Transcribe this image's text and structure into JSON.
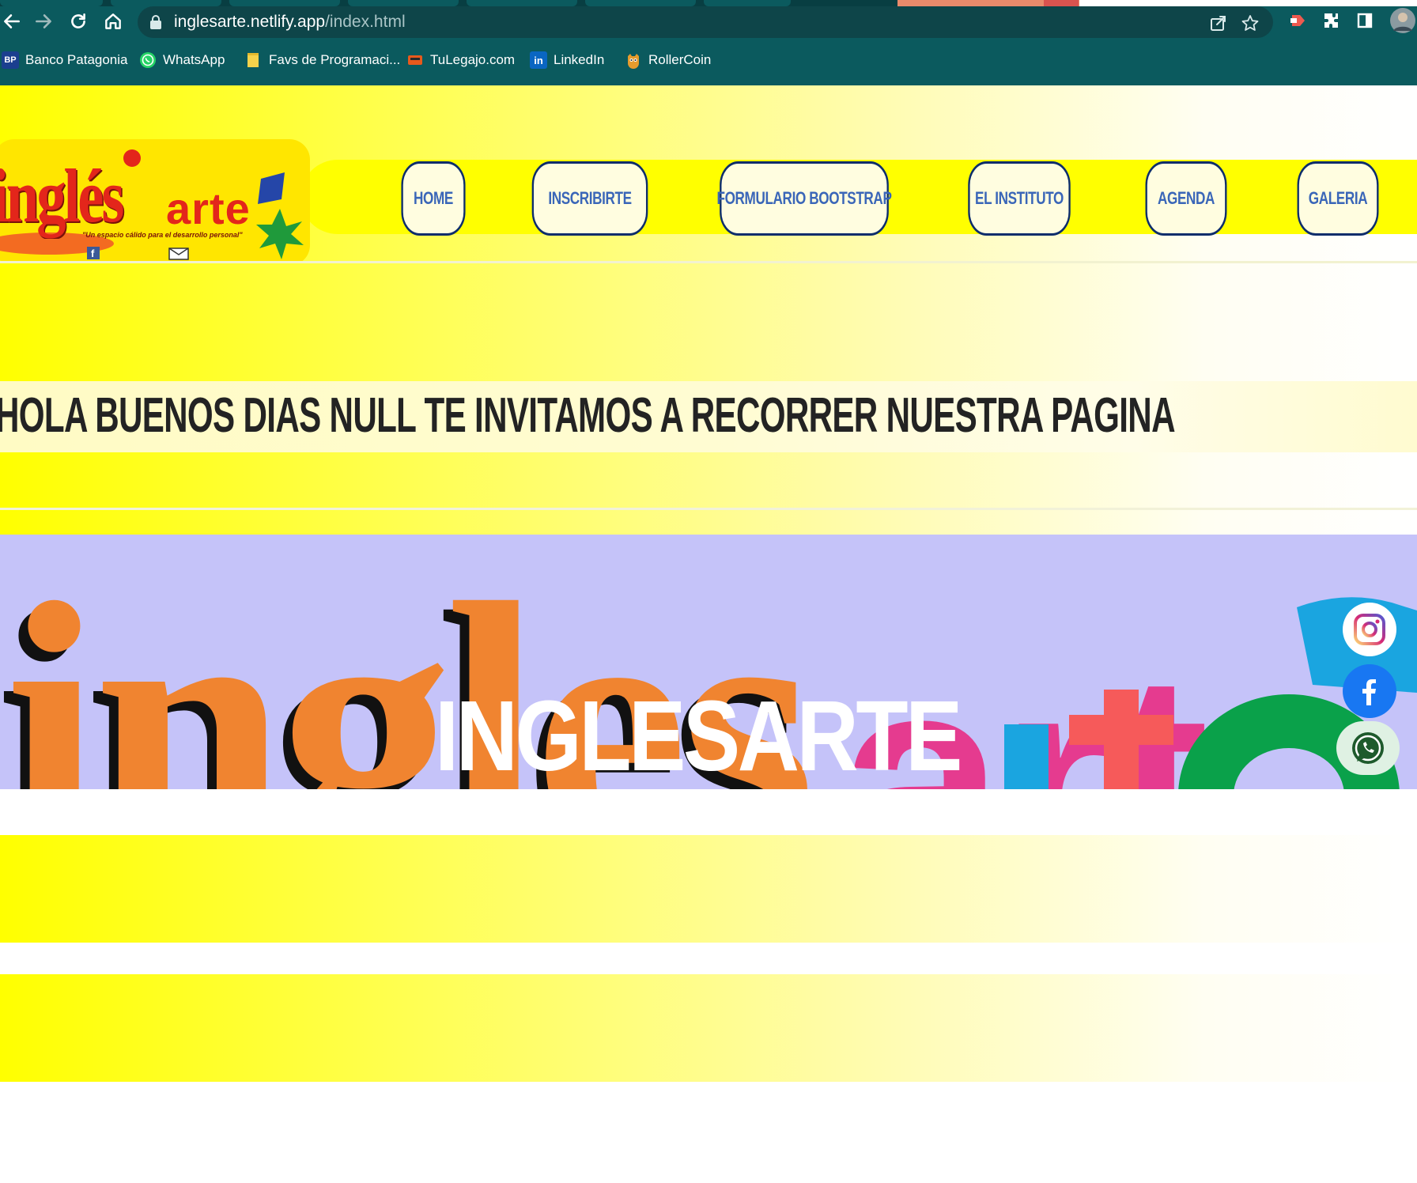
{
  "browser": {
    "url_host": "inglesarte.netlify.app",
    "url_path": "/index.html",
    "bookmarks": [
      {
        "label": "Banco Patagonia",
        "icon": "bp-icon",
        "icon_text": "BP"
      },
      {
        "label": "WhatsApp",
        "icon": "whatsapp-icon"
      },
      {
        "label": "Favs de Programaci...",
        "icon": "folder-icon"
      },
      {
        "label": "TuLegajo.com",
        "icon": "tulegajo-icon"
      },
      {
        "label": "LinkedIn",
        "icon": "linkedin-icon",
        "icon_text": "in"
      },
      {
        "label": "RollerCoin",
        "icon": "rollercoin-icon"
      }
    ]
  },
  "logo": {
    "brand_left": "inglés",
    "brand_right": "arte",
    "tagline": "\"Un espacio cálido para el desarrollo personal\""
  },
  "nav": {
    "items": [
      {
        "label": "HOME"
      },
      {
        "label": "INSCRIBIRTE"
      },
      {
        "label": "FORMULARIO BOOTSTRAP"
      },
      {
        "label": "EL INSTITUTO"
      },
      {
        "label": "AGENDA"
      },
      {
        "label": "GALERIA"
      }
    ]
  },
  "greeting": {
    "text": "HOLA BUENOS DIAS NULL TE INVITAMOS A RECORRER NUESTRA PAGINA"
  },
  "hero": {
    "title": "INGLESARTE",
    "bg_letters_left": "ingles",
    "bg_letters_right": "arte",
    "social": [
      {
        "name": "instagram-icon",
        "color": "#c13584"
      },
      {
        "name": "facebook-icon",
        "color": "#1877f2"
      },
      {
        "name": "whatsapp-icon",
        "color": "#25d366"
      }
    ]
  },
  "colors": {
    "chrome": "#0b5a5e",
    "band_yellow": "#ffff00",
    "nav_border": "#0d2d6b",
    "nav_text": "#3a66b8",
    "hero_bg": "#c5c3f9",
    "brand_orange": "#f08430"
  }
}
